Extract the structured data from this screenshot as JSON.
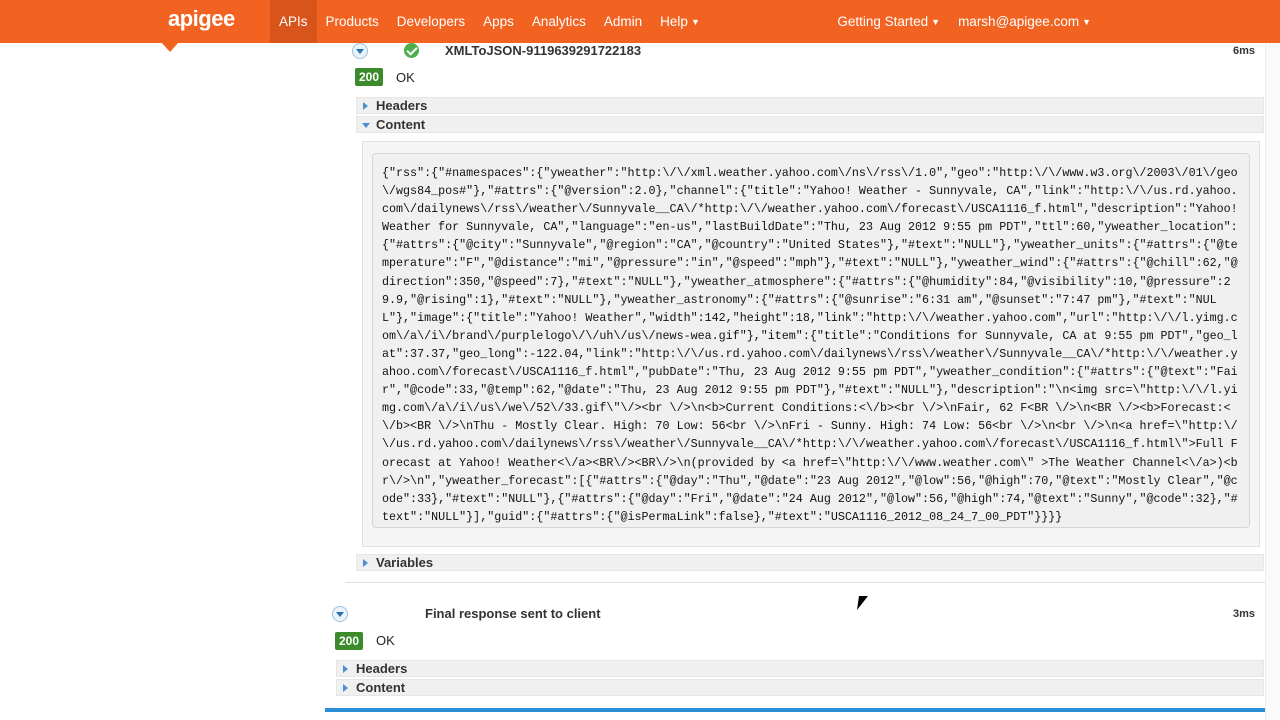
{
  "nav": {
    "logo": "apigee",
    "items": [
      "APIs",
      "Products",
      "Developers",
      "Apps",
      "Analytics",
      "Admin",
      "Help"
    ],
    "active_index": 0,
    "help_has_caret": true,
    "right_items": [
      "Getting Started",
      "marsh@apigee.com"
    ]
  },
  "step1": {
    "title": "XMLToJSON-9119639291722183",
    "duration": "6ms",
    "status_code": "200",
    "status_text": "OK",
    "rows": {
      "headers": "Headers",
      "content": "Content",
      "variables": "Variables"
    },
    "content_text": "{\"rss\":{\"#namespaces\":{\"yweather\":\"http:\\/\\/xml.weather.yahoo.com\\/ns\\/rss\\/1.0\",\"geo\":\"http:\\/\\/www.w3.org\\/2003\\/01\\/geo\\/wgs84_pos#\"},\"#attrs\":{\"@version\":2.0},\"channel\":{\"title\":\"Yahoo! Weather - Sunnyvale, CA\",\"link\":\"http:\\/\\/us.rd.yahoo.com\\/dailynews\\/rss\\/weather\\/Sunnyvale__CA\\/*http:\\/\\/weather.yahoo.com\\/forecast\\/USCA1116_f.html\",\"description\":\"Yahoo! Weather for Sunnyvale, CA\",\"language\":\"en-us\",\"lastBuildDate\":\"Thu, 23 Aug 2012 9:55 pm PDT\",\"ttl\":60,\"yweather_location\":{\"#attrs\":{\"@city\":\"Sunnyvale\",\"@region\":\"CA\",\"@country\":\"United States\"},\"#text\":\"NULL\"},\"yweather_units\":{\"#attrs\":{\"@temperature\":\"F\",\"@distance\":\"mi\",\"@pressure\":\"in\",\"@speed\":\"mph\"},\"#text\":\"NULL\"},\"yweather_wind\":{\"#attrs\":{\"@chill\":62,\"@direction\":350,\"@speed\":7},\"#text\":\"NULL\"},\"yweather_atmosphere\":{\"#attrs\":{\"@humidity\":84,\"@visibility\":10,\"@pressure\":29.9,\"@rising\":1},\"#text\":\"NULL\"},\"yweather_astronomy\":{\"#attrs\":{\"@sunrise\":\"6:31 am\",\"@sunset\":\"7:47 pm\"},\"#text\":\"NULL\"},\"image\":{\"title\":\"Yahoo! Weather\",\"width\":142,\"height\":18,\"link\":\"http:\\/\\/weather.yahoo.com\",\"url\":\"http:\\/\\/l.yimg.com\\/a\\/i\\/brand\\/purplelogo\\/\\/uh\\/us\\/news-wea.gif\"},\"item\":{\"title\":\"Conditions for Sunnyvale, CA at 9:55 pm PDT\",\"geo_lat\":37.37,\"geo_long\":-122.04,\"link\":\"http:\\/\\/us.rd.yahoo.com\\/dailynews\\/rss\\/weather\\/Sunnyvale__CA\\/*http:\\/\\/weather.yahoo.com\\/forecast\\/USCA1116_f.html\",\"pubDate\":\"Thu, 23 Aug 2012 9:55 pm PDT\",\"yweather_condition\":{\"#attrs\":{\"@text\":\"Fair\",\"@code\":33,\"@temp\":62,\"@date\":\"Thu, 23 Aug 2012 9:55 pm PDT\"},\"#text\":\"NULL\"},\"description\":\"\\n<img src=\\\"http:\\/\\/l.yimg.com\\/a\\/i\\/us\\/we\\/52\\/33.gif\\\"\\/><br \\/>\\n<b>Current Conditions:<\\/b><br \\/>\\nFair, 62 F<BR \\/>\\n<BR \\/><b>Forecast:<\\/b><BR \\/>\\nThu - Mostly Clear. High: 70 Low: 56<br \\/>\\nFri - Sunny. High: 74 Low: 56<br \\/>\\n<br \\/>\\n<a href=\\\"http:\\/\\/us.rd.yahoo.com\\/dailynews\\/rss\\/weather\\/Sunnyvale__CA\\/*http:\\/\\/weather.yahoo.com\\/forecast\\/USCA1116_f.html\\\">Full Forecast at Yahoo! Weather<\\/a><BR\\/><BR\\/>\\n(provided by <a href=\\\"http:\\/\\/www.weather.com\\\" >The Weather Channel<\\/a>)<br\\/>\\n\",\"yweather_forecast\":[{\"#attrs\":{\"@day\":\"Thu\",\"@date\":\"23 Aug 2012\",\"@low\":56,\"@high\":70,\"@text\":\"Mostly Clear\",\"@code\":33},\"#text\":\"NULL\"},{\"#attrs\":{\"@day\":\"Fri\",\"@date\":\"24 Aug 2012\",\"@low\":56,\"@high\":74,\"@text\":\"Sunny\",\"@code\":32},\"#text\":\"NULL\"}],\"guid\":{\"#attrs\":{\"@isPermaLink\":false},\"#text\":\"USCA1116_2012_08_24_7_00_PDT\"}}}}"
  },
  "step2": {
    "title": "Final response sent to client",
    "duration": "3ms",
    "status_code": "200",
    "status_text": "OK",
    "rows": {
      "headers": "Headers",
      "content": "Content"
    }
  },
  "colors": {
    "nav_bg": "#f26322",
    "nav_active": "#d9541a",
    "status_badge": "#3c8b2b",
    "accent_line": "#2a8fd8"
  },
  "icons": {
    "expand": "chevron-down-icon",
    "success": "check-circle-icon",
    "collapsed": "triangle-right-icon",
    "expanded": "triangle-down-icon"
  }
}
